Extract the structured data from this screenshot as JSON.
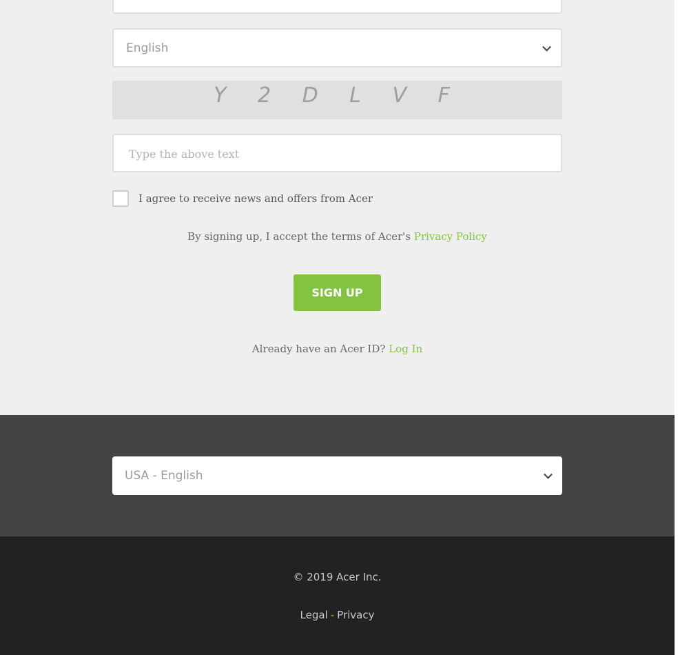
{
  "form": {
    "language_select": {
      "value": "English"
    },
    "captcha": {
      "text": "Y 2 D L V F"
    },
    "captcha_input": {
      "placeholder": "Type the above text",
      "value": ""
    },
    "newsletter_checkbox": {
      "label": "I agree to receive news and offers from Acer",
      "checked": false
    },
    "terms": {
      "text": "By signing up, I accept the terms of Acer's",
      "link": "Privacy Policy"
    },
    "signup_button": {
      "label": "SIGN UP"
    },
    "login_prompt": {
      "text": "Already have an Acer ID?",
      "link": "Log In"
    }
  },
  "region": {
    "select_value": "USA - English"
  },
  "footer": {
    "copyright": "© 2019 Acer Inc.",
    "links": [
      "Legal",
      "Privacy"
    ],
    "separator": "-"
  },
  "colors": {
    "accent": "#83c341",
    "page_bg": "#efefef",
    "region_bg": "#434343",
    "footer_bg": "#222222"
  },
  "icons": [
    "chevron-down-icon"
  ]
}
